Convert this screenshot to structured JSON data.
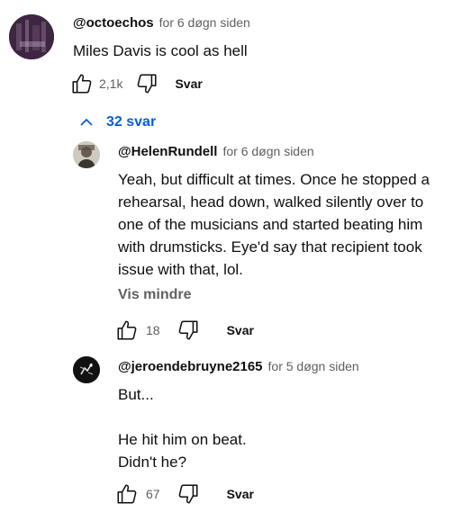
{
  "comment": {
    "handle": "@octoechos",
    "time": "for 6 døgn siden",
    "text": "Miles Davis is cool as hell",
    "likes": "2,1k",
    "reply_label": "Svar",
    "replies_toggle": "32 svar"
  },
  "replies": [
    {
      "handle": "@HelenRundell",
      "time": "for 6 døgn siden",
      "text": "Yeah, but difficult at times. Once he stopped a\nrehearsal, head down, walked silently over to\none of the musicians and started beating him\nwith drumsticks. Eye'd say that recipient took\nissue with that, lol.",
      "show_less": "Vis mindre",
      "likes": "18",
      "reply_label": "Svar"
    },
    {
      "handle": "@jeroendebruyne2165",
      "time": "for 5 døgn siden",
      "text": "But...\n\nHe hit him on beat.\nDidn't he?",
      "likes": "67",
      "reply_label": "Svar"
    }
  ],
  "colors": {
    "link": "#065fd4",
    "secondary_text": "#606060",
    "primary_text": "#0f0f0f"
  },
  "icons": [
    "thumb-up-icon",
    "thumb-down-icon",
    "chevron-up-icon"
  ]
}
